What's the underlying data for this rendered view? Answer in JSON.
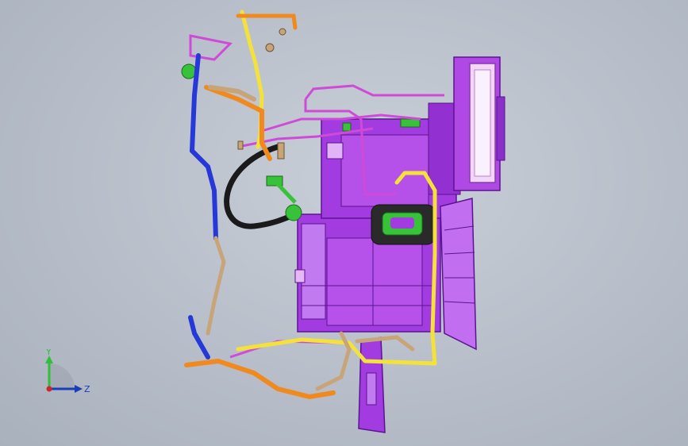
{
  "triad": {
    "y_label": "Y",
    "z_label": "Z"
  },
  "colors": {
    "housing": "#a23be0",
    "housing_dark": "#6a1fa8",
    "housing_light": "#d68cf5",
    "panel": "#f2d8f8",
    "hose_black": "#1a1a1a",
    "pipe_yellow": "#f4e23a",
    "pipe_orange": "#f08a1e",
    "pipe_tan": "#c8a578",
    "pipe_blue": "#2638d8",
    "fitting_green": "#38c23a",
    "wire_magenta": "#d04ad8",
    "axis_y": "#2fbf3a",
    "axis_z": "#1a3db8",
    "axis_x": "#d0242a"
  }
}
